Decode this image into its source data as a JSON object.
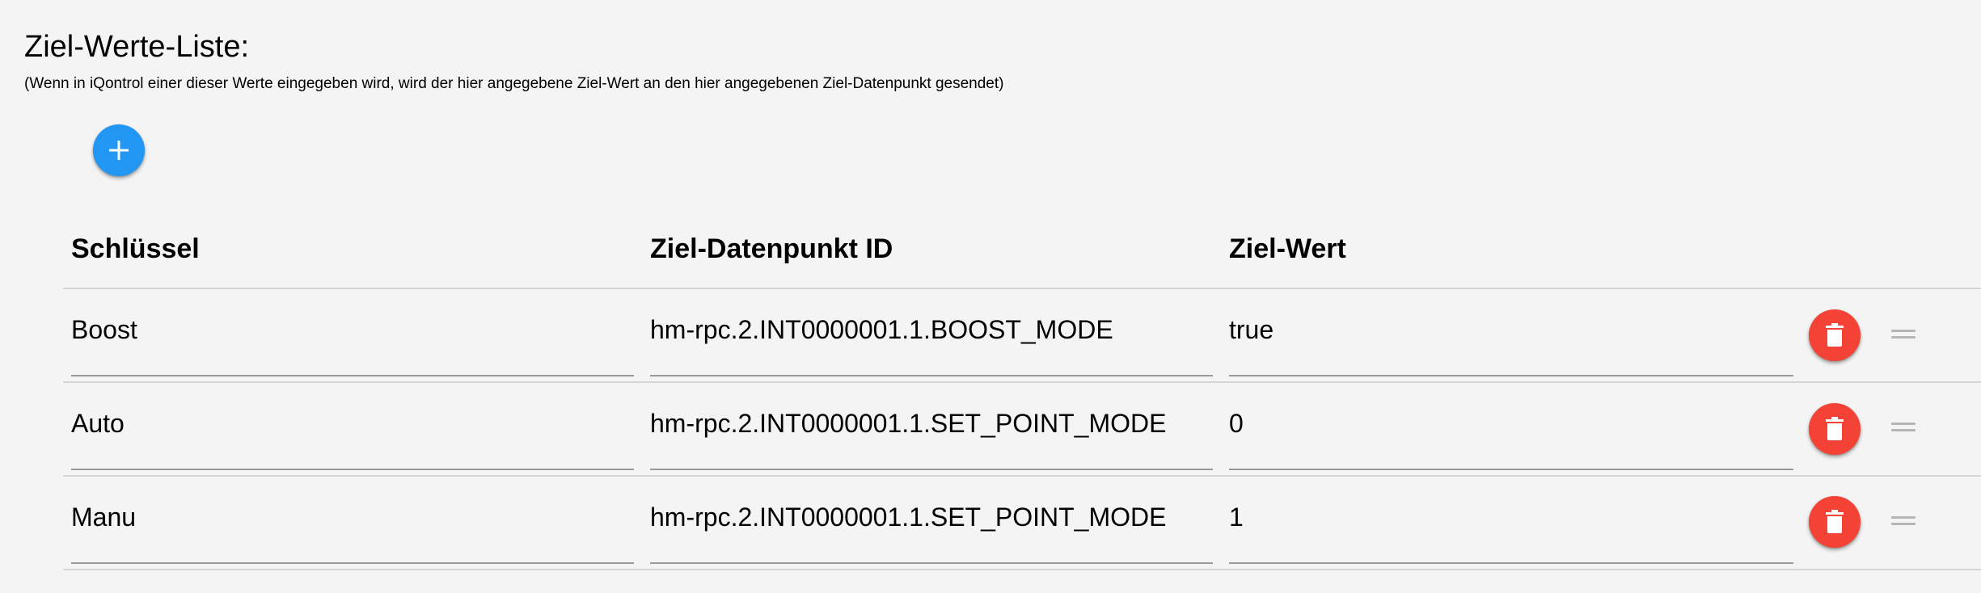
{
  "section": {
    "title": "Ziel-Werte-Liste:",
    "description": "(Wenn in iQontrol einer dieser Werte eingegeben wird, wird der hier angegebene Ziel-Wert an den hier angegebenen Ziel-Datenpunkt gesendet)"
  },
  "toolbar": {
    "add_icon": "plus-icon"
  },
  "table": {
    "headers": [
      "Schlüssel",
      "Ziel-Datenpunkt ID",
      "Ziel-Wert"
    ],
    "rows": [
      {
        "key": "Boost",
        "datapoint": "hm-rpc.2.INT0000001.1.BOOST_MODE",
        "value": "true",
        "delete_icon": "trash-icon",
        "drag_icon": "drag-handle-icon"
      },
      {
        "key": "Auto",
        "datapoint": "hm-rpc.2.INT0000001.1.SET_POINT_MODE",
        "value": "0",
        "delete_icon": "trash-icon",
        "drag_icon": "drag-handle-icon"
      },
      {
        "key": "Manu",
        "datapoint": "hm-rpc.2.INT0000001.1.SET_POINT_MODE",
        "value": "1",
        "delete_icon": "trash-icon",
        "drag_icon": "drag-handle-icon"
      }
    ]
  },
  "colors": {
    "add_button": "#2196f3",
    "delete_button": "#f44336",
    "background": "#f4f4f4"
  }
}
